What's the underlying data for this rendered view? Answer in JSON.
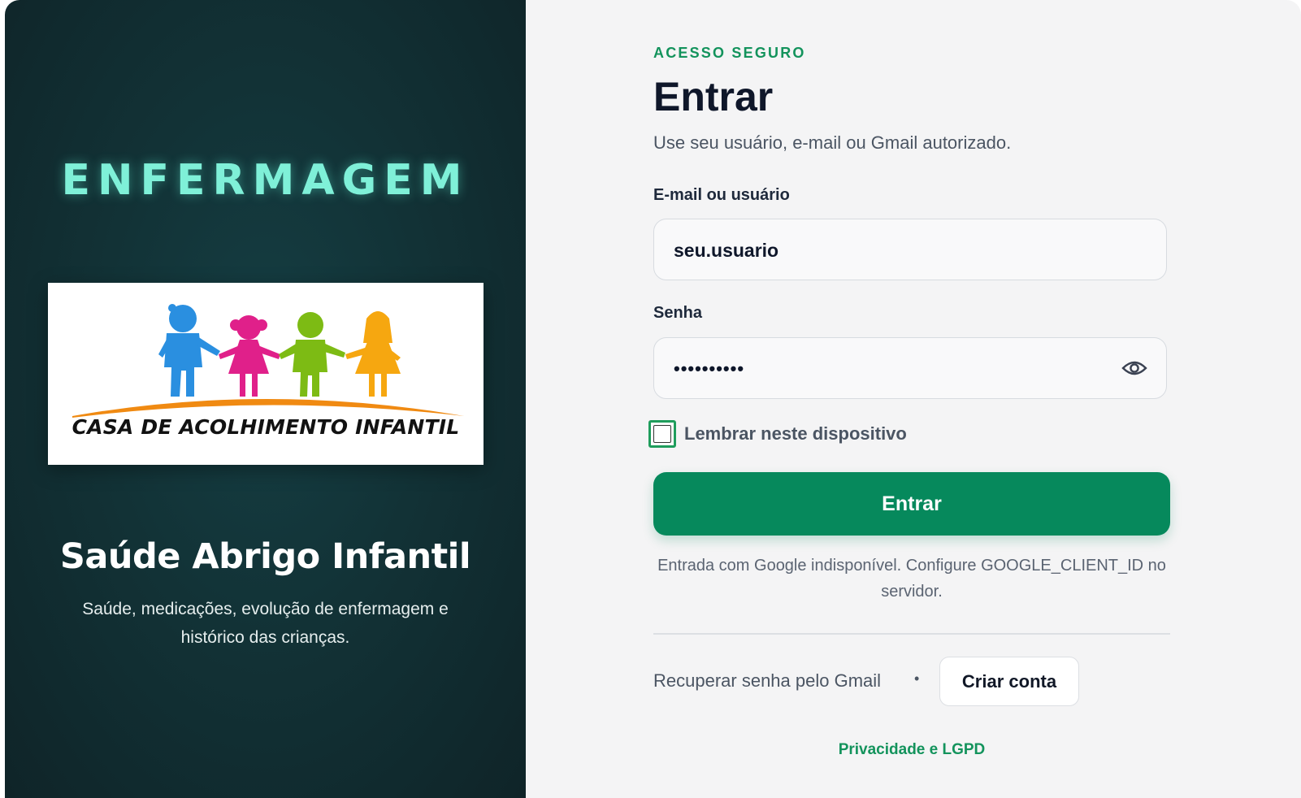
{
  "left_panel": {
    "brand": "ENFERMAGEM",
    "logo_text": "CASA DE ACOLHIMENTO INFANTIL",
    "title": "Saúde Abrigo Infantil",
    "subtitle": "Saúde, medicações, evolução de enfermagem e histórico das crianças."
  },
  "login": {
    "eyebrow": "ACESSO SEGURO",
    "title": "Entrar",
    "subtitle": "Use seu usuário, e-mail ou Gmail autorizado.",
    "user_label": "E-mail ou usuário",
    "user_value": "seu.usuario",
    "password_label": "Senha",
    "password_value": "••••••••••",
    "remember_label": "Lembrar neste dispositivo",
    "remember_checked": false,
    "submit_label": "Entrar",
    "google_note": "Entrada com Google indisponível. Configure GOOGLE_CLIENT_ID no servidor.",
    "recover_link": "Recuperar senha pelo Gmail",
    "separator": "•",
    "create_account": "Criar conta",
    "privacy_link": "Privacidade e LGPD"
  },
  "colors": {
    "accent": "#06895c",
    "eyebrow": "#13935c",
    "brand_glow": "#7ff0d8",
    "left_bg": "#123236",
    "right_bg": "#f4f4f5"
  },
  "icons": {
    "password_toggle": "eye-icon",
    "logo": "children-holding-hands-logo"
  }
}
